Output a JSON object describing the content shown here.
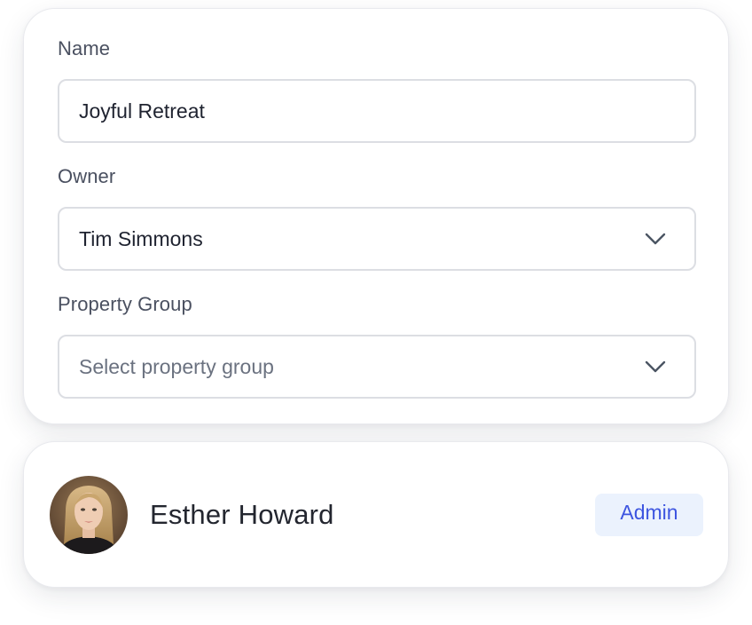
{
  "form": {
    "name_label": "Name",
    "name_value": "Joyful Retreat",
    "owner_label": "Owner",
    "owner_value": "Tim Simmons",
    "property_group_label": "Property Group",
    "property_group_placeholder": "Select property group"
  },
  "member": {
    "name": "Esther Howard",
    "role": "Admin",
    "avatar": "profile-photo"
  },
  "icons": {
    "owner_dropdown": "chevron-down-icon",
    "property_group_dropdown": "chevron-down-icon"
  },
  "colors": {
    "badge_background": "#ebf2fd",
    "badge_text": "#3d55e0",
    "field_border": "#dcdee3",
    "label_text": "#4a5060"
  }
}
